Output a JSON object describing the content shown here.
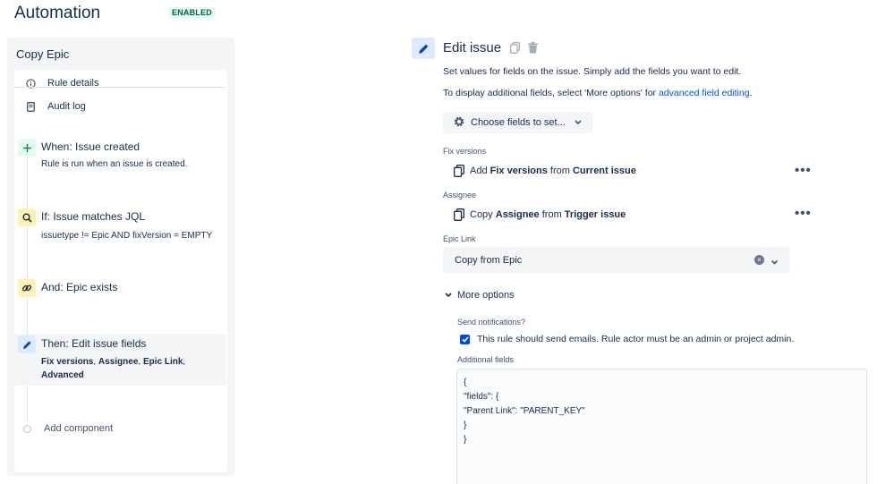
{
  "header": {
    "title": "Automation",
    "status_badge": "ENABLED"
  },
  "rule": {
    "name": "Copy Epic",
    "menu": [
      {
        "label": "Rule details",
        "icon": "info-icon"
      },
      {
        "label": "Audit log",
        "icon": "document-icon"
      }
    ],
    "steps": {
      "trigger": {
        "title": "When: Issue created",
        "desc": "Rule is run when an issue is created."
      },
      "condition_jql": {
        "title": "If: Issue matches JQL",
        "desc": "issuetype != Epic AND fixVersion = EMPTY"
      },
      "condition_epic": {
        "title": "And: Epic exists"
      },
      "action": {
        "title": "Then: Edit issue fields",
        "fields": [
          "Fix versions",
          "Assignee",
          "Epic Link",
          "Advanced"
        ],
        "separator": ", "
      }
    },
    "add_component": "Add component"
  },
  "editor": {
    "title": "Edit issue",
    "desc1": "Set values for fields on the issue. Simply add the fields you want to edit.",
    "desc2_prefix": "To display additional fields, select 'More options' for ",
    "desc2_link": "advanced field editing",
    "desc2_suffix": ".",
    "choose_fields": "Choose fields to set...",
    "fix_versions": {
      "label": "Fix versions",
      "verb": "Add",
      "field": "Fix versions",
      "from": "from",
      "source": "Current issue"
    },
    "assignee": {
      "label": "Assignee",
      "verb": "Copy",
      "field": "Assignee",
      "from": "from",
      "source": "Trigger issue"
    },
    "epic_link": {
      "label": "Epic Link",
      "value": "Copy from Epic"
    },
    "more_options": "More options",
    "send_notifications": {
      "label": "Send notifications?",
      "checkbox_text": "This rule should send emails. Rule actor must be an admin or project admin.",
      "checked": true
    },
    "additional_fields": {
      "label": "Additional fields",
      "value": "{\n\"fields\": {\n\"Parent Link\": \"PARENT_KEY\"\n}\n}"
    }
  },
  "colors": {
    "accent": "#0052cc",
    "badge_bg": "#e3fcef",
    "badge_text": "#006644",
    "trigger_icon_bg": "#e3fcef",
    "condition_icon_bg": "#fff0b3",
    "action_icon_bg": "#deebff"
  }
}
